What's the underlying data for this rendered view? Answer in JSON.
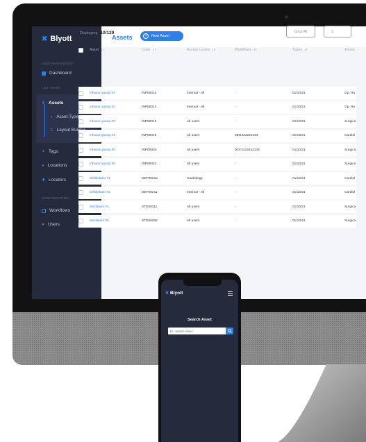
{
  "sidebar": {
    "brand": "Blyott",
    "sections": {
      "user_management": "USER MANAGEMENT",
      "list_views": "LIST VIEWS",
      "configuration": "CONFIGURATION"
    },
    "items": {
      "dashboard": "Dashboard",
      "assets": "Assets",
      "asset_types": "Asset Types",
      "layout_builder": "Layout Builder",
      "tags": "Tags",
      "locations": "Locations",
      "locators": "Locators",
      "workflows": "Workflows",
      "users": "Users"
    }
  },
  "header": {
    "title": "Assets",
    "new_button": "New Asset"
  },
  "toolbar": {
    "displaying_label": "Displaying",
    "displaying_count": "10/129",
    "clear_all": "Clear All",
    "s_button": "S"
  },
  "table": {
    "columns": [
      "Asset",
      "Code",
      "Access Levels",
      "Workflows",
      "Types",
      "Zones"
    ],
    "rows": [
      [
        "Infusion pump #1",
        "INP00012",
        "Internal - All",
        "-",
        "01/10/21",
        "Op. Ro"
      ],
      [
        "Infusion pump #2",
        "INP00013",
        "Internal - All",
        "-",
        "01/10/21",
        "Op. Ro"
      ],
      [
        "Infusion pump #3",
        "INP00015",
        "All users",
        "-",
        "01/10/21",
        "Surgica"
      ],
      [
        "Infusion pump #4",
        "INP00018",
        "All users",
        "0ER433242133",
        "01/10/21",
        "Cardiol"
      ],
      [
        "Infusion pump #5",
        "INP00020",
        "All users",
        "0CF3123442133",
        "01/10/21",
        "Surgica"
      ],
      [
        "Infusion pump #6",
        "INP00022",
        "All users",
        "-",
        "01/10/21",
        "Surgica"
      ],
      [
        "Defibrilator #1",
        "DEF00213",
        "Cardiology",
        "-",
        "01/10/21",
        "Cardiol"
      ],
      [
        "Defibrilator #2",
        "DEF00211",
        "Internal - All",
        "-",
        "01/10/21",
        "Cardiol"
      ],
      [
        "Sterilisers #1",
        "STE00311",
        "All users",
        "-",
        "01/10/21",
        "Surgica"
      ],
      [
        "Sterilisers #2",
        "STE00255",
        "All users",
        "-",
        "01/10/21",
        "Surgica"
      ]
    ]
  },
  "phone": {
    "brand": "Blyott",
    "title": "Search Asset",
    "placeholder": "Ex. Search Asset"
  },
  "colors": {
    "accent": "#2f7fe6",
    "sidebar": "#252a3d",
    "content_bg": "#f4f5f8"
  }
}
